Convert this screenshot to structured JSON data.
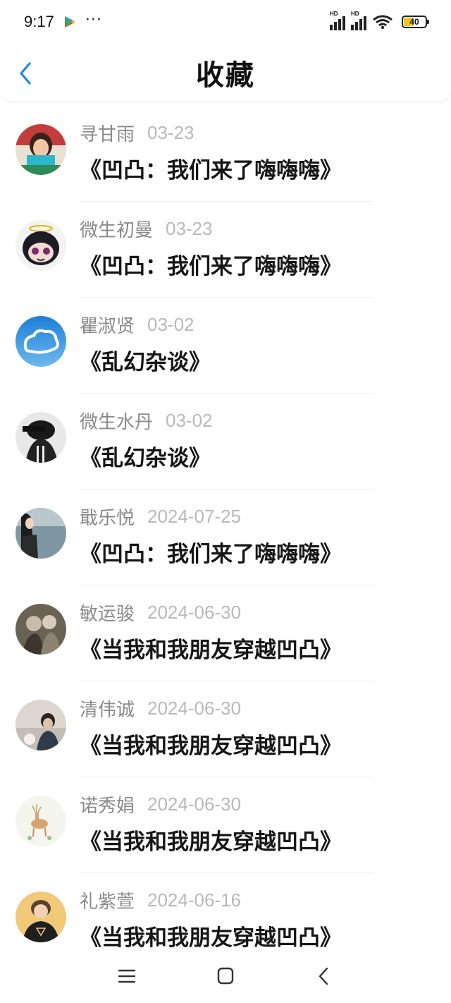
{
  "status_bar": {
    "time": "9:17",
    "dots": "···",
    "hd1": "HD",
    "hd2": "HD",
    "battery": "40",
    "icons": [
      "play-store-icon",
      "signal-icon",
      "signal-icon",
      "wifi-icon",
      "battery-icon"
    ]
  },
  "header": {
    "title": "收藏",
    "back_icon": "chevron-left-icon",
    "accent": "#1e88e5"
  },
  "favorites": [
    {
      "user": "寻甘雨",
      "date": "03-23",
      "work": "《凹凸：我们来了嗨嗨嗨》"
    },
    {
      "user": "微生初曼",
      "date": "03-23",
      "work": "《凹凸：我们来了嗨嗨嗨》"
    },
    {
      "user": "瞿淑贤",
      "date": "03-02",
      "work": "《乱幻杂谈》"
    },
    {
      "user": "微生水丹",
      "date": "03-02",
      "work": "《乱幻杂谈》"
    },
    {
      "user": "戢乐悦",
      "date": "2024-07-25",
      "work": "《凹凸：我们来了嗨嗨嗨》"
    },
    {
      "user": "敏运骏",
      "date": "2024-06-30",
      "work": "《当我和我朋友穿越凹凸》"
    },
    {
      "user": "清伟诚",
      "date": "2024-06-30",
      "work": "《当我和我朋友穿越凹凸》"
    },
    {
      "user": "诺秀娟",
      "date": "2024-06-30",
      "work": "《当我和我朋友穿越凹凸》"
    },
    {
      "user": "礼紫萱",
      "date": "2024-06-16",
      "work": "《当我和我朋友穿越凹凸》"
    }
  ],
  "nav_bar": {
    "icons": [
      "menu-icon",
      "home-square-icon",
      "back-triangle-icon"
    ]
  }
}
